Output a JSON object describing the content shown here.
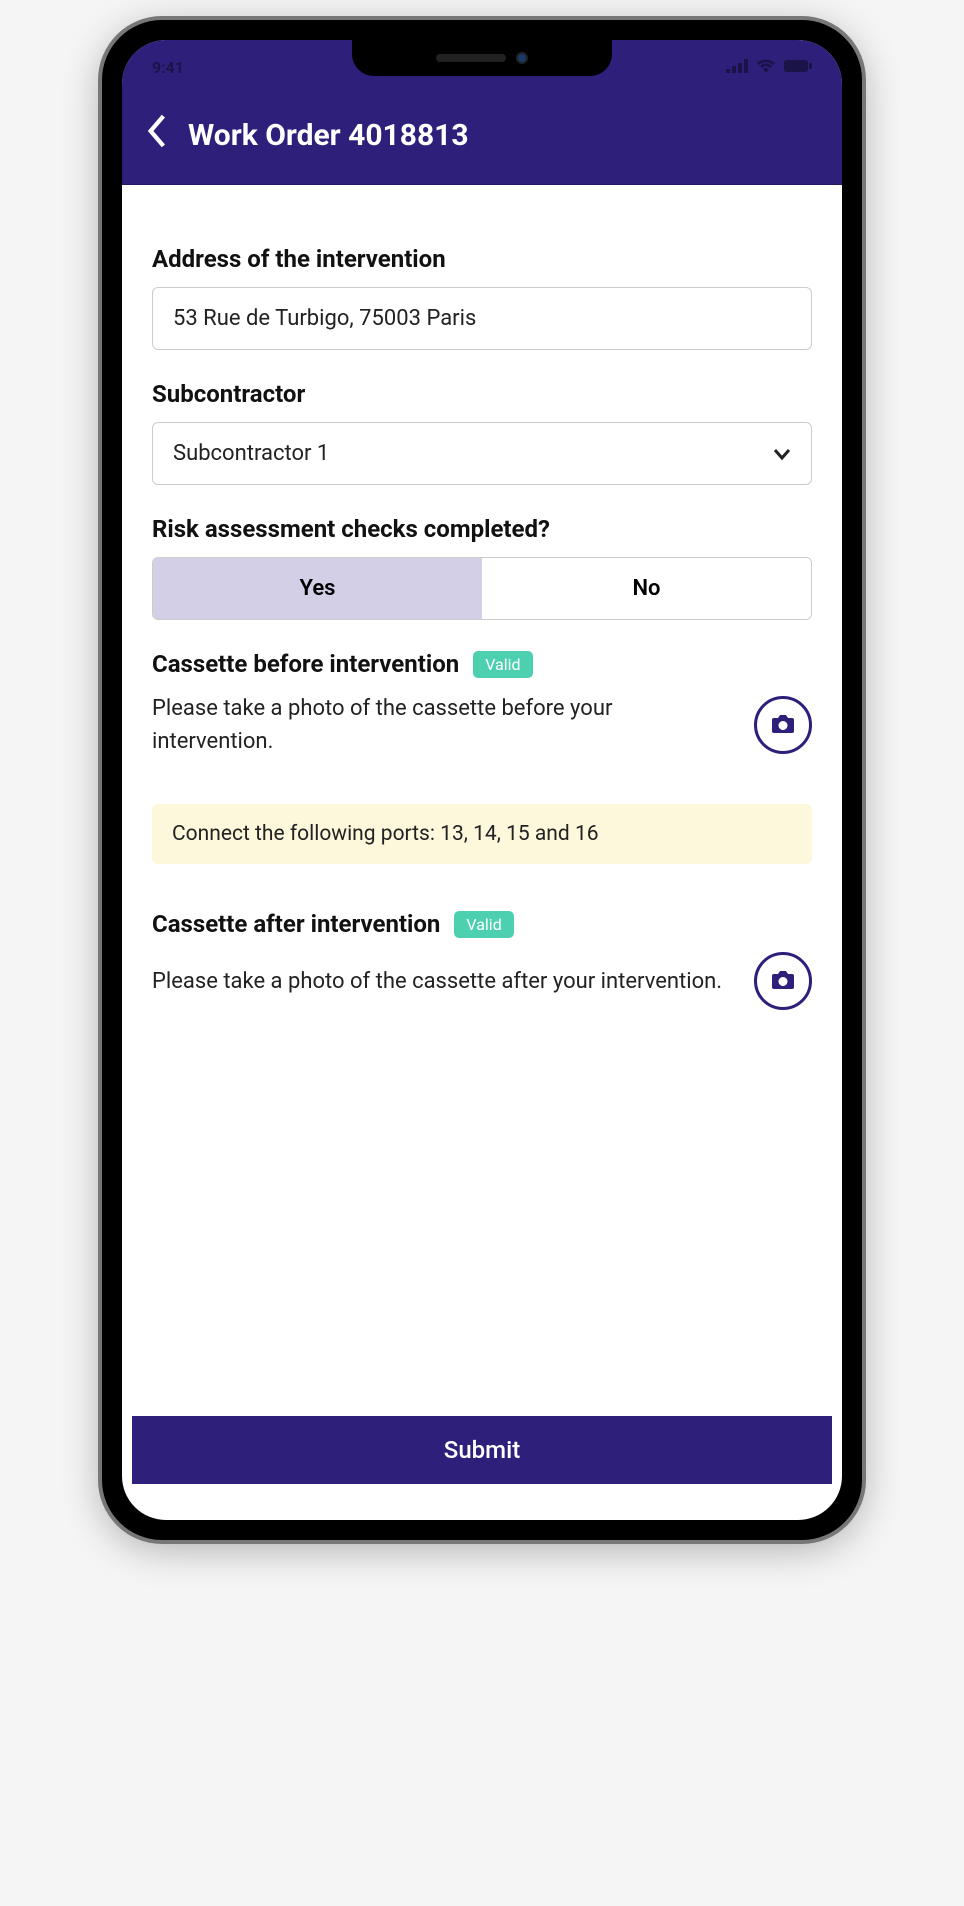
{
  "status": {
    "time": "9:41"
  },
  "header": {
    "title": "Work Order 4018813"
  },
  "fields": {
    "address": {
      "label": "Address of the intervention",
      "value": "53 Rue de Turbigo, 75003 Paris"
    },
    "subcontractor": {
      "label": "Subcontractor",
      "value": "Subcontractor 1"
    },
    "risk": {
      "label": "Risk assessment checks completed?",
      "options": {
        "yes": "Yes",
        "no": "No"
      }
    },
    "cassette_before": {
      "label": "Cassette before intervention",
      "badge": "Valid",
      "text": "Please take a photo of the cassette before your intervention."
    },
    "info": "Connect the following ports: 13, 14, 15 and 16",
    "cassette_after": {
      "label": "Cassette after intervention",
      "badge": "Valid",
      "text": "Please take a photo of the cassette after your intervention."
    }
  },
  "submit": "Submit"
}
